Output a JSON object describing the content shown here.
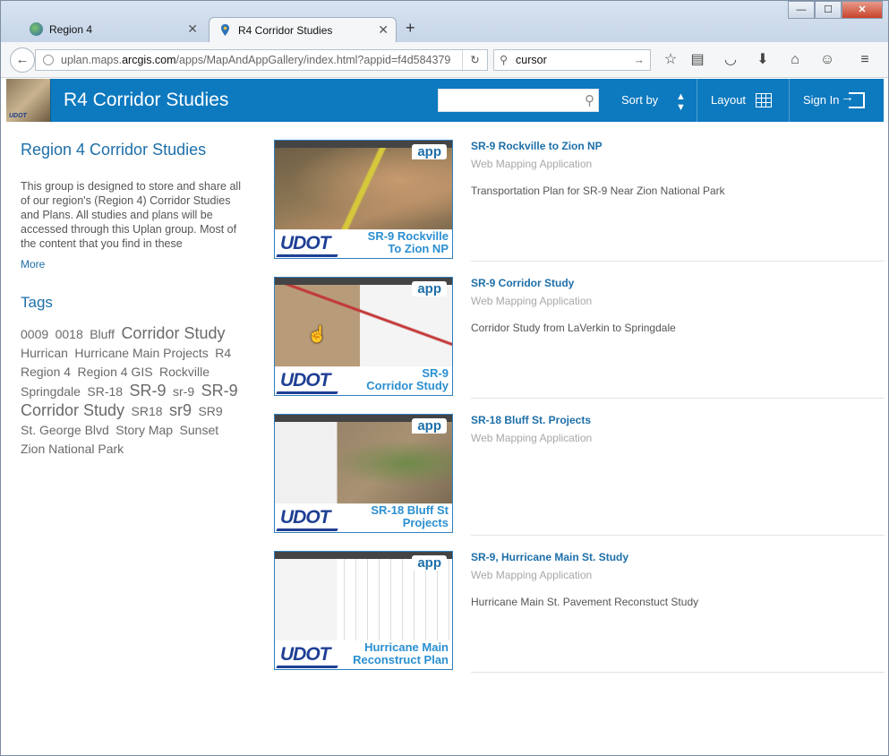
{
  "browser": {
    "tabs": [
      {
        "label": "Region 4"
      },
      {
        "label": "R4 Corridor Studies"
      }
    ],
    "new_tab_label": "+",
    "url_prefix": "uplan.maps.",
    "url_host": "arcgis.com",
    "url_rest": "/apps/MapAndAppGallery/index.html?appid=f4d584379",
    "search_value": "cursor",
    "window_buttons": [
      "—",
      "☐",
      "✕"
    ]
  },
  "header": {
    "logo_text": "UDOT",
    "title": "R4 Corridor Studies",
    "sort_label": "Sort by",
    "layout_label": "Layout",
    "signin_label": "Sign In"
  },
  "group": {
    "title": "Region 4 Corridor Studies",
    "description": "This group is designed to store and share all of our region's (Region 4) Corridor Studies and Plans. All studies and plans will be accessed through this Uplan group. Most of the content that you find in these",
    "more_label": "More",
    "tags_heading": "Tags",
    "tags": [
      {
        "label": "0009",
        "size": 1
      },
      {
        "label": "0018",
        "size": 1
      },
      {
        "label": "Bluff",
        "size": 1
      },
      {
        "label": "Corridor Study",
        "size": 3
      },
      {
        "label": "Hurrican",
        "size": 1
      },
      {
        "label": "Hurricane Main Projects",
        "size": 1
      },
      {
        "label": "R4",
        "size": 1
      },
      {
        "label": "Region 4",
        "size": 1
      },
      {
        "label": "Region 4 GIS",
        "size": 1
      },
      {
        "label": "Rockville",
        "size": 1
      },
      {
        "label": "Springdale",
        "size": 1
      },
      {
        "label": "SR-18",
        "size": 1
      },
      {
        "label": "SR-9",
        "size": 3
      },
      {
        "label": "sr-9",
        "size": 1
      },
      {
        "label": "SR-9 Corridor Study",
        "size": 3
      },
      {
        "label": "SR18",
        "size": 1
      },
      {
        "label": "sr9",
        "size": 3
      },
      {
        "label": "SR9",
        "size": 1
      },
      {
        "label": "St. George Blvd",
        "size": 1
      },
      {
        "label": "Story Map",
        "size": 1
      },
      {
        "label": "Sunset",
        "size": 1
      },
      {
        "label": "Zion National Park",
        "size": 1
      }
    ]
  },
  "results": [
    {
      "title": "SR-9 Rockville to Zion NP",
      "type": "Web Mapping Application",
      "description": "Transportation Plan for SR-9 Near Zion National Park",
      "thumb_caption_1": "SR-9 Rockville",
      "thumb_caption_2": "To Zion NP",
      "badge": "app",
      "logo": "UDOT"
    },
    {
      "title": "SR-9 Corridor Study",
      "type": "Web Mapping Application",
      "description": "Corridor Study from LaVerkin to Springdale",
      "thumb_caption_1": "SR-9",
      "thumb_caption_2": "Corridor Study",
      "badge": "app",
      "logo": "UDOT"
    },
    {
      "title": "SR-18 Bluff St. Projects",
      "type": "Web Mapping Application",
      "description": "",
      "thumb_caption_1": "SR-18 Bluff St",
      "thumb_caption_2": "Projects",
      "badge": "app",
      "logo": "UDOT"
    },
    {
      "title": "SR-9, Hurricane Main St. Study",
      "type": "Web Mapping Application",
      "description": "Hurricane Main St. Pavement Reconstuct Study",
      "thumb_caption_1": "Hurricane Main",
      "thumb_caption_2": "Reconstruct Plan",
      "badge": "app",
      "logo": "UDOT"
    }
  ]
}
